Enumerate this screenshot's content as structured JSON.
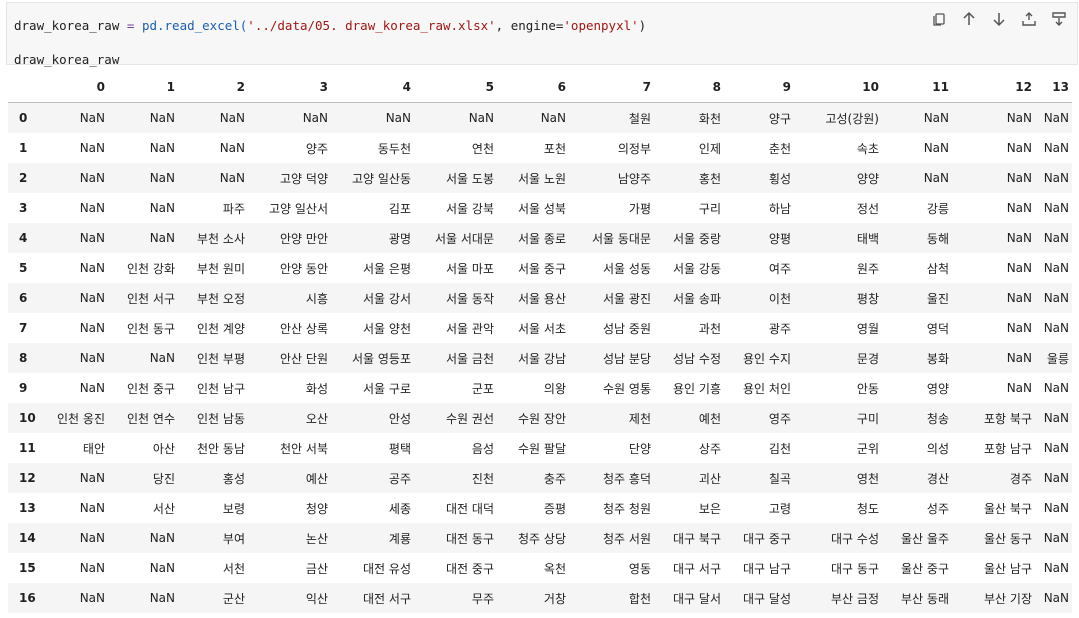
{
  "code_cell": {
    "line1": {
      "var": "draw_korea_raw",
      "assign": " = ",
      "call": "pd.read_excel(",
      "path": "'../data/05. draw_korea_raw.xlsx'",
      "sep": ", ",
      "engine_kw": "engine=",
      "engine_val": "'openpyxl'",
      "close": ")"
    },
    "line2": "draw_korea_raw"
  },
  "toolbar": {
    "icons": [
      "copy-icon",
      "arrow-up-icon",
      "arrow-down-icon",
      "insert-above-icon",
      "insert-below-icon"
    ]
  },
  "dataframe": {
    "columns": [
      "0",
      "1",
      "2",
      "3",
      "4",
      "5",
      "6",
      "7",
      "8",
      "9",
      "10",
      "11",
      "12",
      "13"
    ],
    "rows": [
      {
        "index": "0",
        "cells": [
          "NaN",
          "NaN",
          "NaN",
          "NaN",
          "NaN",
          "NaN",
          "NaN",
          "철원",
          "화천",
          "양구",
          "고성(강원)",
          "NaN",
          "NaN",
          "NaN"
        ]
      },
      {
        "index": "1",
        "cells": [
          "NaN",
          "NaN",
          "NaN",
          "양주",
          "동두천",
          "연천",
          "포천",
          "의정부",
          "인제",
          "춘천",
          "속초",
          "NaN",
          "NaN",
          "NaN"
        ]
      },
      {
        "index": "2",
        "cells": [
          "NaN",
          "NaN",
          "NaN",
          "고양 덕양",
          "고양 일산동",
          "서울 도봉",
          "서울 노원",
          "남양주",
          "홍천",
          "횡성",
          "양양",
          "NaN",
          "NaN",
          "NaN"
        ]
      },
      {
        "index": "3",
        "cells": [
          "NaN",
          "NaN",
          "파주",
          "고양 일산서",
          "김포",
          "서울 강북",
          "서울 성북",
          "가평",
          "구리",
          "하남",
          "정선",
          "강릉",
          "NaN",
          "NaN"
        ]
      },
      {
        "index": "4",
        "cells": [
          "NaN",
          "NaN",
          "부천 소사",
          "안양 만안",
          "광명",
          "서울 서대문",
          "서울 종로",
          "서울 동대문",
          "서울 중랑",
          "양평",
          "태백",
          "동해",
          "NaN",
          "NaN"
        ]
      },
      {
        "index": "5",
        "cells": [
          "NaN",
          "인천 강화",
          "부천 원미",
          "안양 동안",
          "서울 은평",
          "서울 마포",
          "서울 중구",
          "서울 성동",
          "서울 강동",
          "여주",
          "원주",
          "삼척",
          "NaN",
          "NaN"
        ]
      },
      {
        "index": "6",
        "cells": [
          "NaN",
          "인천 서구",
          "부천 오정",
          "시흥",
          "서울 강서",
          "서울 동작",
          "서울 용산",
          "서울 광진",
          "서울 송파",
          "이천",
          "평창",
          "울진",
          "NaN",
          "NaN"
        ]
      },
      {
        "index": "7",
        "cells": [
          "NaN",
          "인천 동구",
          "인천 계양",
          "안산 상록",
          "서울 양천",
          "서울 관악",
          "서울 서초",
          "성남 중원",
          "과천",
          "광주",
          "영월",
          "영덕",
          "NaN",
          "NaN"
        ]
      },
      {
        "index": "8",
        "cells": [
          "NaN",
          "NaN",
          "인천 부평",
          "안산 단원",
          "서울 영등포",
          "서울 금천",
          "서울 강남",
          "성남 분당",
          "성남 수정",
          "용인 수지",
          "문경",
          "봉화",
          "NaN",
          "울릉"
        ]
      },
      {
        "index": "9",
        "cells": [
          "NaN",
          "인천 중구",
          "인천 남구",
          "화성",
          "서울 구로",
          "군포",
          "의왕",
          "수원 영통",
          "용인 기흥",
          "용인 처인",
          "안동",
          "영양",
          "NaN",
          "NaN"
        ]
      },
      {
        "index": "10",
        "cells": [
          "인천 옹진",
          "인천 연수",
          "인천 남동",
          "오산",
          "안성",
          "수원 권선",
          "수원 장안",
          "제천",
          "예천",
          "영주",
          "구미",
          "청송",
          "포항 북구",
          "NaN"
        ]
      },
      {
        "index": "11",
        "cells": [
          "태안",
          "아산",
          "천안 동남",
          "천안 서북",
          "평택",
          "음성",
          "수원 팔달",
          "단양",
          "상주",
          "김천",
          "군위",
          "의성",
          "포항 남구",
          "NaN"
        ]
      },
      {
        "index": "12",
        "cells": [
          "NaN",
          "당진",
          "홍성",
          "예산",
          "공주",
          "진천",
          "충주",
          "청주 흥덕",
          "괴산",
          "칠곡",
          "영천",
          "경산",
          "경주",
          "NaN"
        ]
      },
      {
        "index": "13",
        "cells": [
          "NaN",
          "서산",
          "보령",
          "청양",
          "세종",
          "대전 대덕",
          "증평",
          "청주 청원",
          "보은",
          "고령",
          "청도",
          "성주",
          "울산 북구",
          "NaN"
        ]
      },
      {
        "index": "14",
        "cells": [
          "NaN",
          "NaN",
          "부여",
          "논산",
          "계룡",
          "대전 동구",
          "청주 상당",
          "청주 서원",
          "대구 북구",
          "대구 중구",
          "대구 수성",
          "울산 울주",
          "울산 동구",
          "NaN"
        ]
      },
      {
        "index": "15",
        "cells": [
          "NaN",
          "NaN",
          "서천",
          "금산",
          "대전 유성",
          "대전 중구",
          "옥천",
          "영동",
          "대구 서구",
          "대구 남구",
          "대구 동구",
          "울산 중구",
          "울산 남구",
          "NaN"
        ]
      },
      {
        "index": "16",
        "cells": [
          "NaN",
          "NaN",
          "군산",
          "익산",
          "대전 서구",
          "무주",
          "거창",
          "합천",
          "대구 달서",
          "대구 달성",
          "부산 금정",
          "부산 동래",
          "부산 기장",
          "NaN"
        ]
      }
    ]
  }
}
